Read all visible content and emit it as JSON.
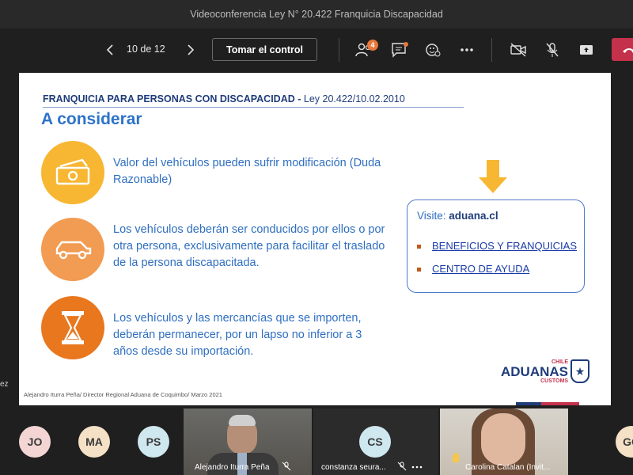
{
  "window": {
    "title": "Videoconferencia Ley N° 20.422 Franquicia Discapacidad"
  },
  "toolbar": {
    "prev_icon": "chevron-left-icon",
    "next_icon": "chevron-right-icon",
    "page_indicator": "10 de 12",
    "take_control_label": "Tomar el control",
    "participants_count": "4",
    "icons": [
      "participants-icon",
      "chat-icon",
      "reactions-icon",
      "more-icon",
      "camera-off-icon",
      "mic-off-icon",
      "share-icon",
      "hangup-icon"
    ],
    "hangup_color": "#c4314b"
  },
  "slide": {
    "header_bold": "FRANQUICIA PARA PERSONAS CON DISCAPACIDAD -",
    "header_rest": " Ley 20.422/10.02.2010",
    "title": "A considerar",
    "items": [
      {
        "icon": "money-icon",
        "color": "#f7b733",
        "text": "Valor del vehículos pueden sufrir modificación (Duda Razonable)"
      },
      {
        "icon": "car-icon",
        "color": "#f29b52",
        "text": "Los vehículos deberán ser conducidos por ellos o por otra persona, exclusivamente para facilitar el traslado de la persona discapacitada."
      },
      {
        "icon": "hourglass-icon",
        "color": "#e8771e",
        "text": "Los vehículos y las mercancías que se importen, deberán permanecer, por un lapso no inferior a 3 años desde su importación."
      }
    ],
    "visit_label": "Visite:",
    "visit_site": "aduana.cl",
    "links": [
      "BENEFICIOS Y FRANQUICIAS",
      "CENTRO DE AYUDA"
    ],
    "footer": "Alejandro Iturra Peña/ Director Regional Aduana de Coquimbo/ Marzo 2021",
    "brand_country": "CHILE",
    "brand_name": "ADUANAS",
    "brand_sub": "CUSTOMS"
  },
  "edge_fragment": "ez",
  "participants": [
    {
      "initials": "JO",
      "color": "#f3d6d3"
    },
    {
      "initials": "MA",
      "color": "#f5e1c6"
    },
    {
      "initials": "PS",
      "color": "#cfe7ee"
    },
    {
      "name": "Alejandro Iturra Peña",
      "mic": "mic-off-icon"
    },
    {
      "initials": "CS",
      "color": "#cfe7ee",
      "name": "constanza seura...",
      "mic": "mic-off-icon",
      "more": "more-icon"
    },
    {
      "name": "Carolina Catalan (Invit...",
      "raised": "hand-raised-icon"
    },
    {
      "initials": "GO",
      "color": "#f5e1c6"
    }
  ]
}
